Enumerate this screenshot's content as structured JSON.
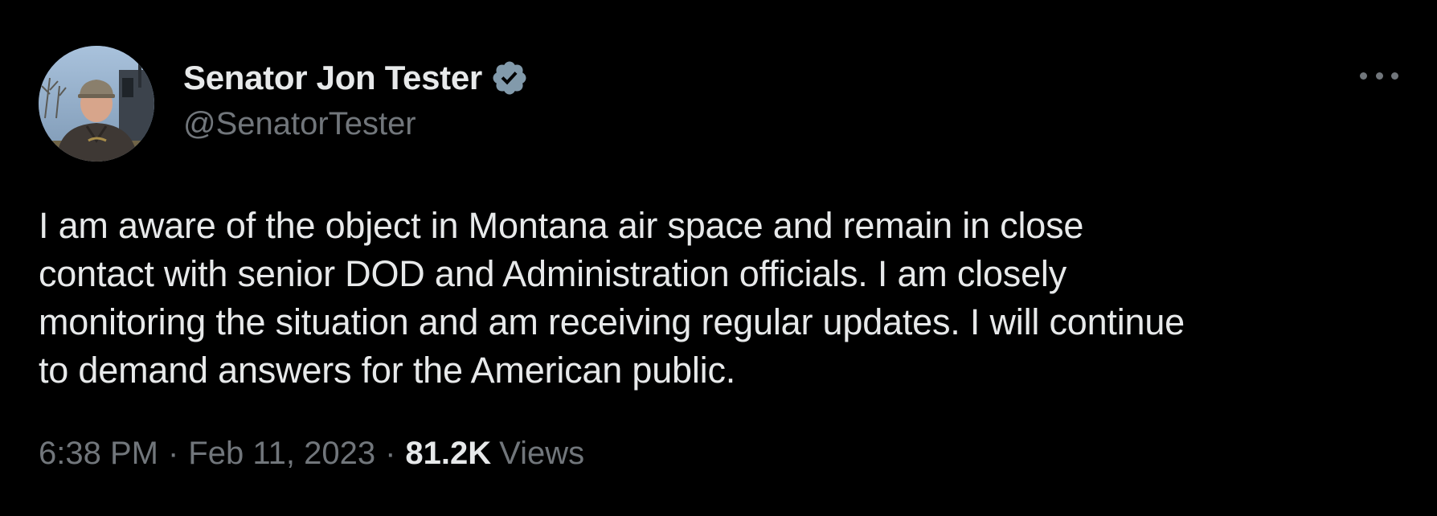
{
  "author": {
    "display_name": "Senator Jon Tester",
    "handle": "@SenatorTester",
    "verified": true,
    "verified_color": "#829aab",
    "avatar_icon": "profile-photo"
  },
  "more_icon": "more-options-icon",
  "tweet": {
    "text": "I am aware of the object in Montana air space and remain in close\ncontact with senior DOD and Administration officials. I am closely\nmonitoring the situation and am receiving regular updates. I will continue\nto demand answers for the American public."
  },
  "meta": {
    "time": "6:38 PM",
    "separator": "·",
    "date": "Feb 11, 2023",
    "views_count": "81.2K",
    "views_label": "Views"
  },
  "colors": {
    "background": "#000000",
    "primary_text": "#e7e9ea",
    "secondary_text": "#71767b"
  }
}
